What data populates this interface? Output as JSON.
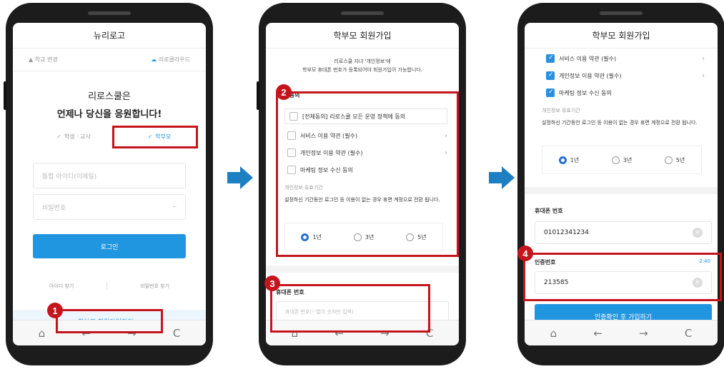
{
  "screen1": {
    "title": "뉴리로고",
    "tab_school": "학교 변경",
    "tab_cloud": "리로클라우드",
    "headline1": "리로스쿨은",
    "headline2": "언제나 당신을 응원합니다!",
    "role_student": "학생 · 교사",
    "role_parent": "학부모",
    "id_placeholder": "통합 아이디(이메일)",
    "pw_placeholder": "비밀번호",
    "login_label": "로그인",
    "find_id": "아이디 찾기",
    "find_pw": "비밀번호 찾기",
    "signup_link": "학부모 회원가입하기 >"
  },
  "screen2": {
    "title": "학부모 회원가입",
    "notice_line1": "리로스쿨 자녀 '개인정보'에",
    "notice_line2": "학부모 휴대폰 번호가 등록되어야 회원가입이 가능합니다.",
    "terms_title": "약관동의",
    "agree_all": "[전체동의] 리로스쿨 모든 운영 정책에 동의",
    "terms": [
      "서비스 이용 약관 (필수)",
      "개인정보 이용 약관 (필수)",
      "마케팅 정보 수신 동의"
    ],
    "retention_label": "개인정보 유효기간",
    "retention_desc": "설정하신 기간동안 로그인 등 이용이 없는 경우 휴면 계정으로 전환 됩니다.",
    "period_options": [
      "1년",
      "3년",
      "5년"
    ],
    "phone_label": "휴대폰 번호",
    "phone_placeholder": "휴대폰 번호('-'없이 숫자만 입력)"
  },
  "screen3": {
    "title": "학부모 회원가입",
    "terms": [
      "서비스 이용 약관 (필수)",
      "개인정보 이용 약관 (필수)",
      "마케팅 정보 수신 동의"
    ],
    "retention_label": "개인정보 유효기간",
    "retention_desc": "설정하신 기간동안 로그인 등 이용이 없는 경우 휴면 계정으로 전환 됩니다.",
    "period_options": [
      "1년",
      "3년",
      "5년"
    ],
    "phone_label": "휴대폰 번호",
    "phone_value": "01012341234",
    "code_label": "인증번호",
    "timer": "2:40",
    "code_value": "213585",
    "submit_label": "인증확인 후 가입하기"
  },
  "badges": [
    "1",
    "2",
    "3",
    "4"
  ],
  "nav": {
    "home": "⌂",
    "back": "←",
    "forward": "→",
    "refresh": "C"
  },
  "colors": {
    "accent": "#2196e0",
    "highlight": "#c4141c",
    "arrow": "#1e7fc3"
  }
}
